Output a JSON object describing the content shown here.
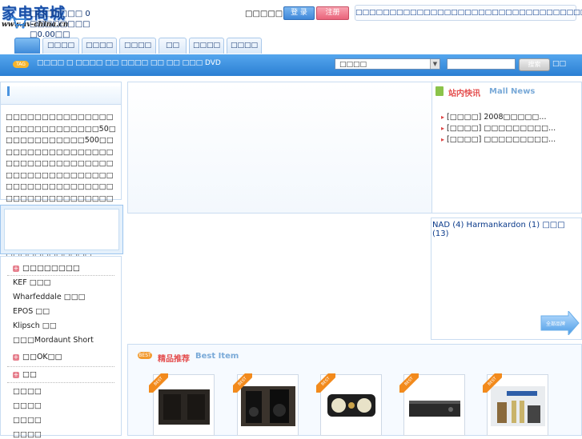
{
  "header": {
    "logo_text": "家电商城",
    "logo_url_text": "www.av-china.cn",
    "welcome": "□□□□□□",
    "login_label": "登 录",
    "register_label": "注册",
    "top_links": [
      "□□□□□",
      "□□□□",
      "□□□□",
      "□□□□",
      "□□□□",
      "□□□□",
      "□□□□",
      "□□□□□□"
    ]
  },
  "tabs": [
    "",
    "□□□□",
    "□□□□",
    "□□□□",
    "□□",
    "□□□□",
    "□□□□"
  ],
  "search_bar": {
    "badge": "TAG",
    "hot_words": "□□□□ □ □□□□ □□ □□□□ □□ □□ □□□ DVD",
    "category_value": "□□□□",
    "search_input_value": "",
    "search_button": "搜索",
    "extra": "□□"
  },
  "intro": {
    "text": "□□□□□□□□□□□□□□□□□□□□□□□□□□□□50□□□□□□□□□□□□500□□□□□□□□□□□□□□□□□□□□□□□□□□□□□□□□□□□□□□□□□□□□□□□□□□□□□□□□□□□□□□□□□□□□□□□□□□□□□□□□□□□□□□□□□□□□□□□□□□□□□□□□□□□□□□HIFI□□□□□□□□□□□□□□□□□□□□□□□□□□□□□□□□□□□□□"
  },
  "cart": {
    "line1": "□□□□□□□ 0 □□□□□□□□",
    "line2": "□0.00□□"
  },
  "brand_list": {
    "groups": [
      {
        "title": "□□□□□□□□",
        "items": [
          "KEF □□□",
          "Wharfeddale □□□",
          "EPOS □□",
          "Klipsch □□",
          "□□□Mordaunt Short"
        ]
      },
      {
        "title": "□□OK□□",
        "items": []
      },
      {
        "title": "□□",
        "items": [
          "□□□□",
          "□□□□",
          "□□□□",
          "□□□□"
        ]
      }
    ]
  },
  "news": {
    "title": "站内快讯",
    "subtitle": "Mall News",
    "items": [
      "[□□□□] 2008□□□□□...",
      "[□□□□] □□□□□□□□□...",
      "[□□□□] □□□□□□□□□..."
    ]
  },
  "brand_links": "NAD (4) Harmankardon (1) □□□ (13)",
  "all_brands_label": "全部品牌",
  "best_items": {
    "badge": "BEST",
    "title": "精品推荐",
    "subtitle": "Best Item",
    "ribbon": "BEST",
    "colors": {
      "ribbon": "#f28a1c"
    }
  },
  "colors": {
    "accent_blue": "#2b7fd3",
    "title_red": "#e44d4d",
    "link_blue": "#0a3a8a"
  }
}
